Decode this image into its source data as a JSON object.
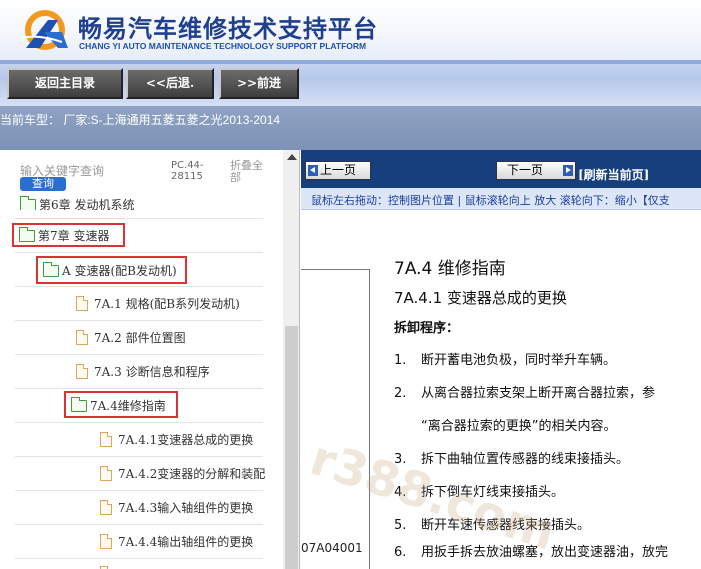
{
  "header": {
    "brand_title": "畅易汽车维修技术支持平台",
    "brand_subtitle": "CHANG YI AUTO MAINTENANCE TECHNOLOGY SUPPORT PLATFORM",
    "logo_icon": "cy-logo-icon"
  },
  "nav": {
    "home_label": "返回主目录",
    "back_label": "<<后退.",
    "forward_label": ">>前进"
  },
  "model_bar": {
    "text": "当前车型：  厂家:S-上海通用五菱五菱之光2013-2014"
  },
  "tree": {
    "search_placeholder": "输入关键字查询",
    "search_button": "查询",
    "code": "PC.44-28115",
    "collapse_all": "折叠全部",
    "partial_item": "第6章 发动机系统",
    "items": [
      {
        "label": "第7章 变速器",
        "type": "folder",
        "highlighted": true
      },
      {
        "label": "A 变速器(配B发动机)",
        "type": "folder",
        "highlighted": true
      },
      {
        "label": "7A.1 规格(配B系列发动机)",
        "type": "doc"
      },
      {
        "label": "7A.2 部件位置图",
        "type": "doc"
      },
      {
        "label": "7A.3 诊断信息和程序",
        "type": "doc"
      },
      {
        "label": "7A.4维修指南",
        "type": "folder",
        "highlighted": true
      },
      {
        "label": "7A.4.1变速器总成的更换",
        "type": "doc"
      },
      {
        "label": "7A.4.2变速器的分解和装配",
        "type": "doc"
      },
      {
        "label": "7A.4.3输入轴组件的更换",
        "type": "doc"
      },
      {
        "label": "7A.4.4输出轴组件的更换",
        "type": "doc"
      }
    ]
  },
  "doc_toolbar": {
    "prev_label": "上一页",
    "next_label": "下一页",
    "refresh_label": "[刷新当前页]",
    "hint": "鼠标左右拖动：控制图片位置 | 鼠标滚轮向上 放大  滚轮向下：缩小【仅支"
  },
  "document": {
    "h1": "7A.4 维修指南",
    "h2": "7A.4.1  变速器总成的更换",
    "h3": "拆卸程序：",
    "figure_code": "07A04001",
    "steps": [
      {
        "num": "1.",
        "text": "断开蓄电池负极，同时举升车辆。"
      },
      {
        "num": "2.",
        "text": "从离合器拉索支架上断开离合器拉索，参"
      },
      {
        "num": "",
        "text": "“离合器拉索的更换”的相关内容。"
      },
      {
        "num": "3.",
        "text": "拆下曲轴位置传感器的线束接插头。"
      },
      {
        "num": "4.",
        "text": "拆下倒车灯线束接插头。"
      },
      {
        "num": "5.",
        "text": "断开车速传感器线束接插头。"
      },
      {
        "num": "6.",
        "text": "用扳手拆去放油螺塞，放出变速器油，放完"
      }
    ],
    "watermark": "r388.com"
  }
}
